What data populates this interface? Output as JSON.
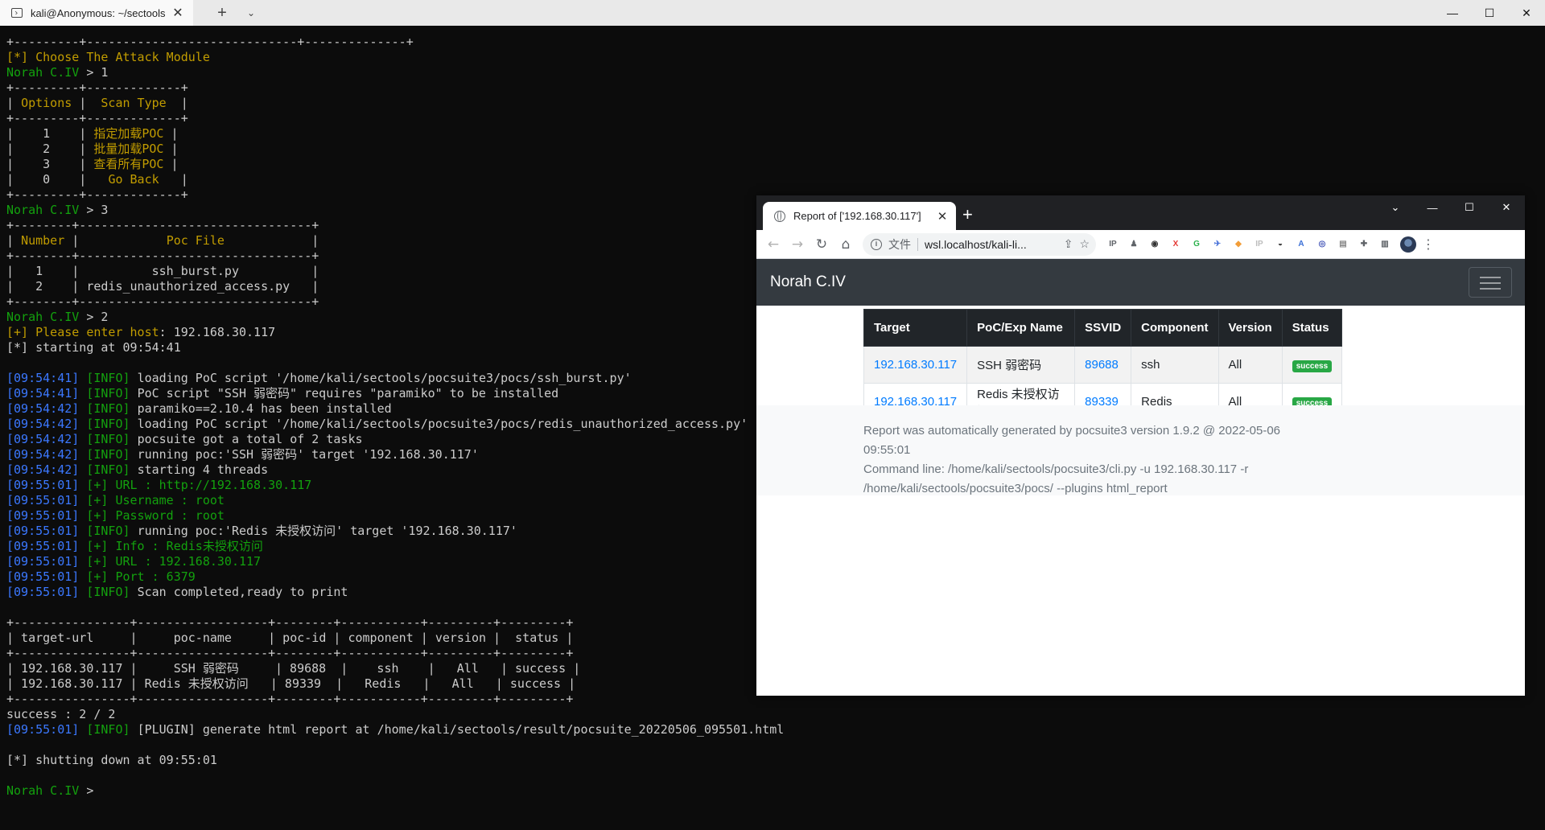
{
  "terminal_window": {
    "tab_title": "kali@Anonymous: ~/sectools",
    "close_glyph": "✕",
    "new_tab_glyph": "+",
    "dropdown_glyph": "⌄",
    "controls": {
      "minimize": "—",
      "maximize": "☐",
      "close": "✕"
    }
  },
  "terminal_lines": [
    [
      {
        "t": "+---------+-----------------------------+--------------+",
        "c": "w"
      }
    ],
    [
      {
        "t": "[*] Choose The Attack Module",
        "c": "y"
      }
    ],
    [
      {
        "t": "Norah C.IV",
        "c": "g"
      },
      {
        "t": " > 1",
        "c": "w"
      }
    ],
    [
      {
        "t": "+---------+-------------+",
        "c": "w"
      }
    ],
    [
      {
        "t": "| ",
        "c": "w"
      },
      {
        "t": "Options",
        "c": "y"
      },
      {
        "t": " |  ",
        "c": "w"
      },
      {
        "t": "Scan Type",
        "c": "y"
      },
      {
        "t": "  |",
        "c": "w"
      }
    ],
    [
      {
        "t": "+---------+-------------+",
        "c": "w"
      }
    ],
    [
      {
        "t": "|    1    | ",
        "c": "w"
      },
      {
        "t": "指定加载POC",
        "c": "y"
      },
      {
        "t": " |",
        "c": "w"
      }
    ],
    [
      {
        "t": "|    2    | ",
        "c": "w"
      },
      {
        "t": "批量加载POC",
        "c": "y"
      },
      {
        "t": " |",
        "c": "w"
      }
    ],
    [
      {
        "t": "|    3    | ",
        "c": "w"
      },
      {
        "t": "查看所有POC",
        "c": "y"
      },
      {
        "t": " |",
        "c": "w"
      }
    ],
    [
      {
        "t": "|    0    |   ",
        "c": "w"
      },
      {
        "t": "Go Back",
        "c": "y"
      },
      {
        "t": "   |",
        "c": "w"
      }
    ],
    [
      {
        "t": "+---------+-------------+",
        "c": "w"
      }
    ],
    [
      {
        "t": "Norah C.IV",
        "c": "g"
      },
      {
        "t": " > 3",
        "c": "w"
      }
    ],
    [
      {
        "t": "+--------+--------------------------------+",
        "c": "w"
      }
    ],
    [
      {
        "t": "| ",
        "c": "w"
      },
      {
        "t": "Number",
        "c": "y"
      },
      {
        "t": " |            ",
        "c": "w"
      },
      {
        "t": "Poc File",
        "c": "y"
      },
      {
        "t": "            |",
        "c": "w"
      }
    ],
    [
      {
        "t": "+--------+--------------------------------+",
        "c": "w"
      }
    ],
    [
      {
        "t": "|   1    |          ssh_burst.py          |",
        "c": "w"
      }
    ],
    [
      {
        "t": "|   2    | redis_unauthorized_access.py   |",
        "c": "w"
      }
    ],
    [
      {
        "t": "+--------+--------------------------------+",
        "c": "w"
      }
    ],
    [
      {
        "t": "Norah C.IV",
        "c": "g"
      },
      {
        "t": " > 2",
        "c": "w"
      }
    ],
    [
      {
        "t": "[+] Please enter host",
        "c": "y"
      },
      {
        "t": ": 192.168.30.117",
        "c": "w"
      }
    ],
    [
      {
        "t": "[*] starting at 09:54:41",
        "c": "w"
      }
    ],
    [
      {
        "t": "",
        "c": "w"
      }
    ],
    [
      {
        "t": "[09:54:41]",
        "c": "b"
      },
      {
        "t": " [INFO] ",
        "c": "g"
      },
      {
        "t": "loading PoC script '/home/kali/sectools/pocsuite3/pocs/ssh_burst.py'",
        "c": "w"
      }
    ],
    [
      {
        "t": "[09:54:41]",
        "c": "b"
      },
      {
        "t": " [INFO] ",
        "c": "g"
      },
      {
        "t": "PoC script \"SSH 弱密码\" requires \"paramiko\" to be installed",
        "c": "w"
      }
    ],
    [
      {
        "t": "[09:54:42]",
        "c": "b"
      },
      {
        "t": " [INFO] ",
        "c": "g"
      },
      {
        "t": "paramiko==2.10.4 has been installed",
        "c": "w"
      }
    ],
    [
      {
        "t": "[09:54:42]",
        "c": "b"
      },
      {
        "t": " [INFO] ",
        "c": "g"
      },
      {
        "t": "loading PoC script '/home/kali/sectools/pocsuite3/pocs/redis_unauthorized_access.py'",
        "c": "w"
      }
    ],
    [
      {
        "t": "[09:54:42]",
        "c": "b"
      },
      {
        "t": " [INFO] ",
        "c": "g"
      },
      {
        "t": "pocsuite got a total of 2 tasks",
        "c": "w"
      }
    ],
    [
      {
        "t": "[09:54:42]",
        "c": "b"
      },
      {
        "t": " [INFO] ",
        "c": "g"
      },
      {
        "t": "running poc:'SSH 弱密码' target '192.168.30.117'",
        "c": "w"
      }
    ],
    [
      {
        "t": "[09:54:42]",
        "c": "b"
      },
      {
        "t": " [INFO] ",
        "c": "g"
      },
      {
        "t": "starting 4 threads",
        "c": "w"
      }
    ],
    [
      {
        "t": "[09:55:01]",
        "c": "b"
      },
      {
        "t": " [+] URL : http://192.168.30.117",
        "c": "g"
      }
    ],
    [
      {
        "t": "[09:55:01]",
        "c": "b"
      },
      {
        "t": " [+] Username : root",
        "c": "g"
      }
    ],
    [
      {
        "t": "[09:55:01]",
        "c": "b"
      },
      {
        "t": " [+] Password : root",
        "c": "g"
      }
    ],
    [
      {
        "t": "[09:55:01]",
        "c": "b"
      },
      {
        "t": " [INFO] ",
        "c": "g"
      },
      {
        "t": "running poc:'Redis 未授权访问' target '192.168.30.117'",
        "c": "w"
      }
    ],
    [
      {
        "t": "[09:55:01]",
        "c": "b"
      },
      {
        "t": " [+] Info : Redis未授权访问",
        "c": "g"
      }
    ],
    [
      {
        "t": "[09:55:01]",
        "c": "b"
      },
      {
        "t": " [+] URL : 192.168.30.117",
        "c": "g"
      }
    ],
    [
      {
        "t": "[09:55:01]",
        "c": "b"
      },
      {
        "t": " [+] Port : 6379",
        "c": "g"
      }
    ],
    [
      {
        "t": "[09:55:01]",
        "c": "b"
      },
      {
        "t": " [INFO] ",
        "c": "g"
      },
      {
        "t": "Scan completed,ready to print",
        "c": "w"
      }
    ],
    [
      {
        "t": "",
        "c": "w"
      }
    ],
    [
      {
        "t": "+----------------+------------------+--------+-----------+---------+---------+",
        "c": "w"
      }
    ],
    [
      {
        "t": "| target-url     |     poc-name     | poc-id | component | version |  status |",
        "c": "w"
      }
    ],
    [
      {
        "t": "+----------------+------------------+--------+-----------+---------+---------+",
        "c": "w"
      }
    ],
    [
      {
        "t": "| 192.168.30.117 |     SSH 弱密码     | 89688  |    ssh    |   All   | success |",
        "c": "w"
      }
    ],
    [
      {
        "t": "| 192.168.30.117 | Redis 未授权访问   | 89339  |   Redis   |   All   | success |",
        "c": "w"
      }
    ],
    [
      {
        "t": "+----------------+------------------+--------+-----------+---------+---------+",
        "c": "w"
      }
    ],
    [
      {
        "t": "success : 2 / 2",
        "c": "w"
      }
    ],
    [
      {
        "t": "[09:55:01]",
        "c": "b"
      },
      {
        "t": " [INFO] ",
        "c": "g"
      },
      {
        "t": "[PLUGIN] generate html report at /home/kali/sectools/result/pocsuite_20220506_095501.html",
        "c": "w"
      }
    ],
    [
      {
        "t": "",
        "c": "w"
      }
    ],
    [
      {
        "t": "[*] shutting down at 09:55:01",
        "c": "w"
      }
    ],
    [
      {
        "t": "",
        "c": "w"
      }
    ],
    [
      {
        "t": "Norah C.IV",
        "c": "g"
      },
      {
        "t": " >",
        "c": "w"
      }
    ]
  ],
  "browser": {
    "tab_title": "Report of ['192.168.30.117']",
    "tab_close": "✕",
    "new_tab": "+",
    "controls": {
      "dropdown": "⌄",
      "minimize": "—",
      "maximize": "☐",
      "close": "✕"
    },
    "nav": {
      "back": "←",
      "forward": "→",
      "reload": "↻",
      "home": "⌂"
    },
    "omnibox": {
      "info": "i",
      "secure_label": "文件",
      "url": "wsl.localhost/kali-li...",
      "share": "⇪",
      "star": "☆"
    },
    "extensions": [
      {
        "name": "ip-extension-icon",
        "label": "IP",
        "color": "#5f6368"
      },
      {
        "name": "puzzle-user-icon",
        "label": "♟",
        "color": "#5f6368"
      },
      {
        "name": "glasses-icon",
        "label": "◉",
        "color": "#333333"
      },
      {
        "name": "x-extension-icon",
        "label": "X",
        "color": "#e53935"
      },
      {
        "name": "green-extension-icon",
        "label": "G",
        "color": "#2bb24c"
      },
      {
        "name": "bird-extension-icon",
        "label": "✈",
        "color": "#4a73d9"
      },
      {
        "name": "shield-extension-icon",
        "label": "◆",
        "color": "#f29d38"
      },
      {
        "name": "ip-grey-extension-icon",
        "label": "IP",
        "color": "#bdbdbd"
      },
      {
        "name": "hat-extension-icon",
        "label": "◒",
        "color": "#444444"
      },
      {
        "name": "translate-extension-icon",
        "label": "A",
        "color": "#3b6fd6"
      },
      {
        "name": "circle-extension-icon",
        "label": "◎",
        "color": "#3f51b5"
      },
      {
        "name": "card-extension-icon",
        "label": "▤",
        "color": "#888888"
      },
      {
        "name": "puzzle-icon",
        "label": "✚",
        "color": "#5f6368"
      },
      {
        "name": "sidebar-icon",
        "label": "▥",
        "color": "#5f6368"
      }
    ],
    "menu": "⋮"
  },
  "report": {
    "brand": "Norah C.IV",
    "headers": [
      "Target",
      "PoC/Exp Name",
      "SSVID",
      "Component",
      "Version",
      "Status"
    ],
    "rows": [
      {
        "target": "192.168.30.117",
        "poc": "SSH 弱密码",
        "ssvid": "89688",
        "component": "ssh",
        "version": "All",
        "status": "success"
      },
      {
        "target": "192.168.30.117",
        "poc": "Redis 未授权访问",
        "ssvid": "89339",
        "component": "Redis",
        "version": "All",
        "status": "success"
      }
    ],
    "footer_line1": "Report was automatically generated by pocsuite3 version 1.9.2 @ 2022-05-06 09:55:01",
    "footer_line2": "Command line: /home/kali/sectools/pocsuite3/cli.py -u 192.168.30.117 -r /home/kali/sectools/pocsuite3/pocs/ --plugins html_report"
  }
}
